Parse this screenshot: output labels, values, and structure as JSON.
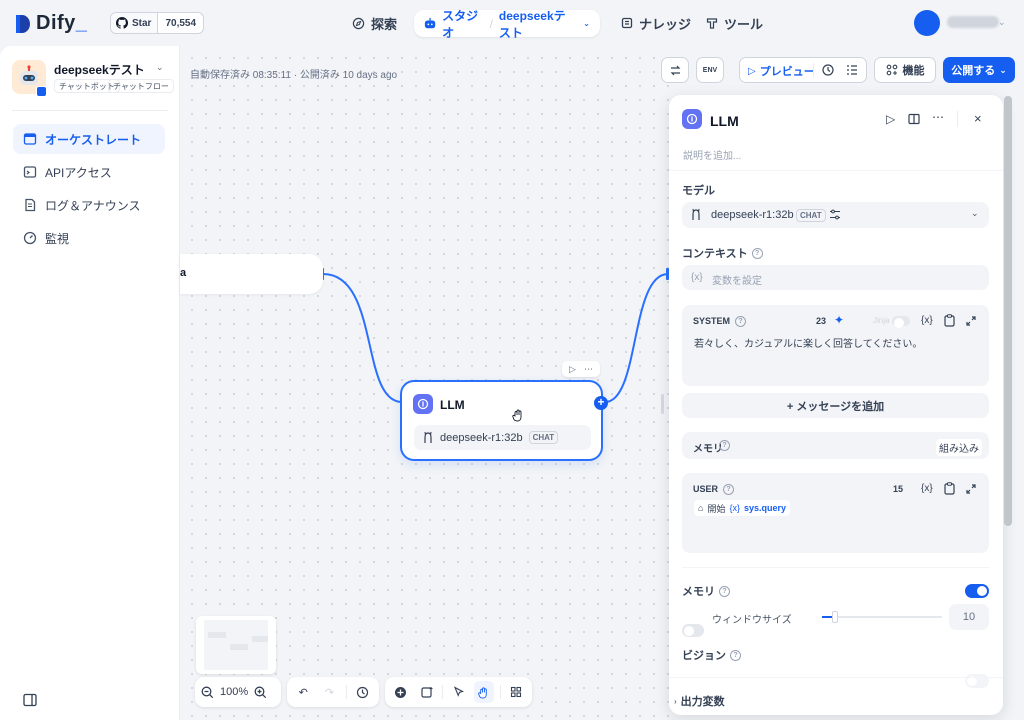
{
  "topbar": {
    "brand": "Dify",
    "github_label": "Star",
    "github_count": "70,554",
    "nav_explore": "探索",
    "nav_studio": "スタジオ",
    "nav_studio_app": "deepseekテスト",
    "nav_knowledge": "ナレッジ",
    "nav_tools": "ツール",
    "accent": "#155eef"
  },
  "sidebar": {
    "app_name": "deepseekテスト",
    "tag1": "チャットボット",
    "tag2": "チャットフロー",
    "items": [
      {
        "label": "オーケストレート",
        "icon": "terminal-window-icon",
        "active": true
      },
      {
        "label": "APIアクセス",
        "icon": "api-terminal-icon",
        "active": false
      },
      {
        "label": "ログ＆アナウンス",
        "icon": "file-list-icon",
        "active": false
      },
      {
        "label": "監視",
        "icon": "dashboard-icon",
        "active": false
      }
    ]
  },
  "canvas": {
    "autosave": "自動保存済み 08:35:11 · 公開済み 10 days ago",
    "start_node_cut_text": "a",
    "llm_node": {
      "title": "LLM",
      "model": "deepseek-r1:32b",
      "badge": "CHAT"
    },
    "zoom": "100%"
  },
  "header": {
    "preview": "プレビュー",
    "features": "機能",
    "publish": "公開する",
    "env_label": "ENV"
  },
  "panel": {
    "title": "LLM",
    "description_placeholder": "説明を追加...",
    "model_label": "モデル",
    "model_name": "deepseek-r1:32b",
    "model_badge": "CHAT",
    "context_label": "コンテキスト",
    "context_placeholder": "変数を設定",
    "system": {
      "label": "SYSTEM",
      "count": "23",
      "jinja": "Jinja",
      "text": "若々しく、カジュアルに楽しく回答してください。"
    },
    "add_message": "+ メッセージを追加",
    "memory_row_label": "メモリ",
    "memory_builtin": "組み込み",
    "user": {
      "label": "USER",
      "count": "15",
      "var_node": "開始",
      "var_name": "sys.query"
    },
    "memory_label": "メモリ",
    "window_size_label": "ウィンドウサイズ",
    "window_size_value": "10",
    "vision_label": "ビジョン",
    "output_label": "出力変数"
  }
}
